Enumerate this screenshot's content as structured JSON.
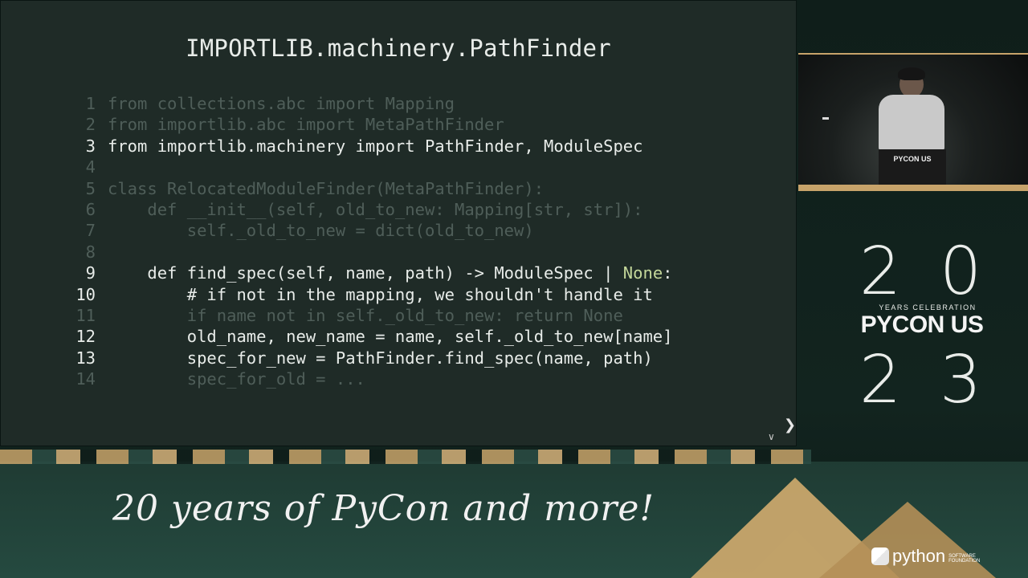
{
  "slide": {
    "title": "IMPORTLIB.machinery.PathFinder",
    "code_lines": [
      {
        "n": "1",
        "hl": false,
        "text": "from collections.abc import Mapping"
      },
      {
        "n": "2",
        "hl": false,
        "text": "from importlib.abc import MetaPathFinder"
      },
      {
        "n": "3",
        "hl": true,
        "text": "from importlib.machinery import PathFinder, ModuleSpec"
      },
      {
        "n": "4",
        "hl": false,
        "text": ""
      },
      {
        "n": "5",
        "hl": false,
        "text": "class RelocatedModuleFinder(MetaPathFinder):"
      },
      {
        "n": "6",
        "hl": false,
        "text": "    def __init__(self, old_to_new: Mapping[str, str]):"
      },
      {
        "n": "7",
        "hl": false,
        "text": "        self._old_to_new = dict(old_to_new)"
      },
      {
        "n": "8",
        "hl": false,
        "text": ""
      },
      {
        "n": "9",
        "hl": true,
        "text": "    def find_spec(self, name, path) -> ModuleSpec | None:"
      },
      {
        "n": "10",
        "hl": true,
        "text": "        # if not in the mapping, we shouldn't handle it"
      },
      {
        "n": "11",
        "hl": false,
        "text": "        if name not in self._old_to_new: return None"
      },
      {
        "n": "12",
        "hl": true,
        "text": "        old_name, new_name = name, self._old_to_new[name]"
      },
      {
        "n": "13",
        "hl": true,
        "text": "        spec_for_new = PathFinder.find_spec(name, path)"
      },
      {
        "n": "14",
        "hl": false,
        "text": "        spec_for_old = ..."
      }
    ],
    "nav": {
      "next_icon": "chevron-right-icon",
      "down_icon": "chevron-down-icon"
    }
  },
  "camera": {
    "podium_label": "PYCON US"
  },
  "logo": {
    "digit_1": "2",
    "digit_2": "0",
    "digit_3": "2",
    "digit_4": "3",
    "years_celebration": "YEARS CELEBRATION",
    "pycon_us": "PYCON US"
  },
  "tagline": "20 years of PyCon and more!",
  "python_logo": {
    "text": "python",
    "sub": "SOFTWARE FOUNDATION"
  },
  "colors": {
    "slide_bg": "#1f2b27",
    "accent_gold": "#c7a36a",
    "code_bright": "#e8ece9",
    "code_dim": "#4f5e59",
    "keyword_none": "#c4d79a"
  }
}
